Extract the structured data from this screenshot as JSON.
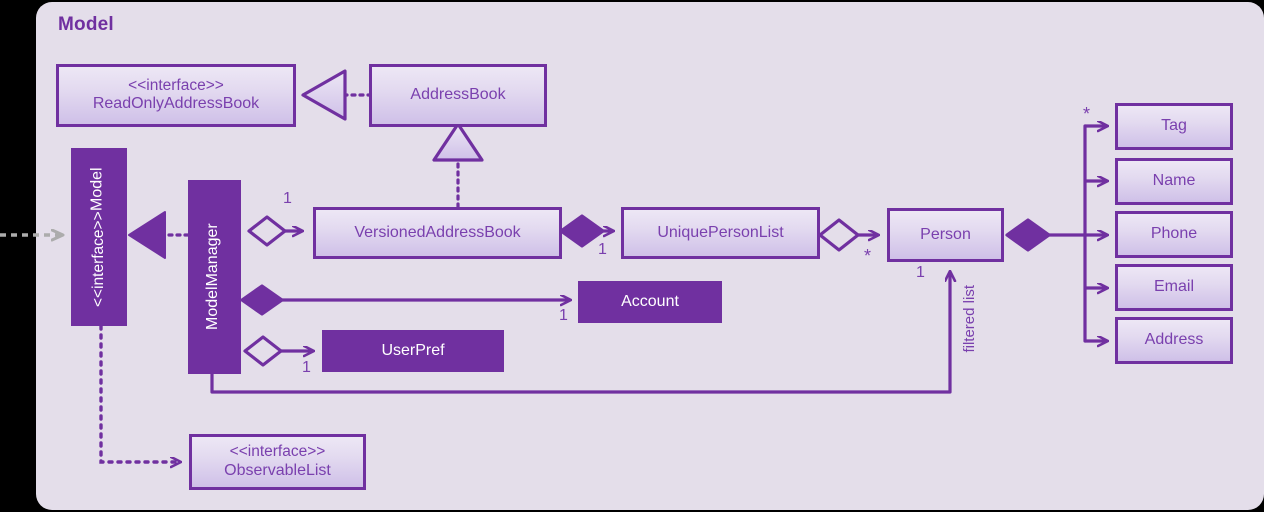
{
  "diagram": {
    "title": "Model",
    "type": "uml-class-diagram",
    "colors": {
      "panel_background": "#E4DEEA",
      "accent": "#7030A0",
      "text_purple": "#7A40AE",
      "light_box_top": "#EDE7F5",
      "light_box_bottom": "#CFC0E8",
      "dark_box_fill": "#7030A0",
      "dark_box_text": "#FFFFFF",
      "external_arrow_gray": "#ACACAC",
      "canvas_background": "#000000"
    }
  },
  "classes": {
    "read_only_address_book": {
      "stereotype": "<<interface>>",
      "name": "ReadOnlyAddressBook",
      "style": "light"
    },
    "address_book": {
      "name": "AddressBook",
      "style": "light"
    },
    "model": {
      "stereotype": "<<interface>>",
      "name": "Model",
      "style": "dark",
      "orientation": "vertical"
    },
    "model_manager": {
      "name": "ModelManager",
      "style": "dark",
      "orientation": "vertical"
    },
    "versioned_address_book": {
      "name": "VersionedAddressBook",
      "style": "light"
    },
    "unique_person_list": {
      "name": "UniquePersonList",
      "style": "light"
    },
    "person": {
      "name": "Person",
      "style": "light"
    },
    "account": {
      "name": "Account",
      "style": "dark"
    },
    "user_pref": {
      "name": "UserPref",
      "style": "dark"
    },
    "observable_list": {
      "stereotype": "<<interface>>",
      "name": "ObservableList",
      "style": "light"
    },
    "tag": {
      "name": "Tag",
      "style": "light"
    },
    "name_attr": {
      "name": "Name",
      "style": "light"
    },
    "phone": {
      "name": "Phone",
      "style": "light"
    },
    "email": {
      "name": "Email",
      "style": "light"
    },
    "address": {
      "name": "Address",
      "style": "light"
    }
  },
  "multiplicities": {
    "model_manager_to_versioned": "1",
    "versioned_to_unique_person_list": "1",
    "model_manager_to_account": "1",
    "model_manager_to_user_pref": "1",
    "unique_person_list_to_person": "*",
    "person_to_attributes": "*",
    "filtered_list_to_person": "1"
  },
  "edge_labels": {
    "filtered_list": "filtered list"
  },
  "relationships": [
    {
      "from": "AddressBook",
      "to": "ReadOnlyAddressBook",
      "type": "realization"
    },
    {
      "from": "VersionedAddressBook",
      "to": "AddressBook",
      "type": "generalization"
    },
    {
      "from": "ModelManager",
      "to": "Model",
      "type": "realization"
    },
    {
      "from": "ModelManager",
      "to": "VersionedAddressBook",
      "type": "aggregation",
      "multiplicity": "1"
    },
    {
      "from": "ModelManager",
      "to": "Account",
      "type": "composition",
      "multiplicity": "1"
    },
    {
      "from": "ModelManager",
      "to": "UserPref",
      "type": "aggregation",
      "multiplicity": "1"
    },
    {
      "from": "VersionedAddressBook",
      "to": "UniquePersonList",
      "type": "composition",
      "multiplicity": "1"
    },
    {
      "from": "UniquePersonList",
      "to": "Person",
      "type": "aggregation",
      "multiplicity": "*"
    },
    {
      "from": "Person",
      "to": "Tag",
      "type": "composition",
      "multiplicity": "*"
    },
    {
      "from": "Person",
      "to": "Name",
      "type": "composition"
    },
    {
      "from": "Person",
      "to": "Phone",
      "type": "composition"
    },
    {
      "from": "Person",
      "to": "Email",
      "type": "composition"
    },
    {
      "from": "Person",
      "to": "Address",
      "type": "composition"
    },
    {
      "from": "Model",
      "to": "ObservableList",
      "type": "dependency"
    },
    {
      "from": "ModelManager",
      "to": "Person",
      "type": "association",
      "label": "filtered list",
      "multiplicity": "1"
    }
  ]
}
